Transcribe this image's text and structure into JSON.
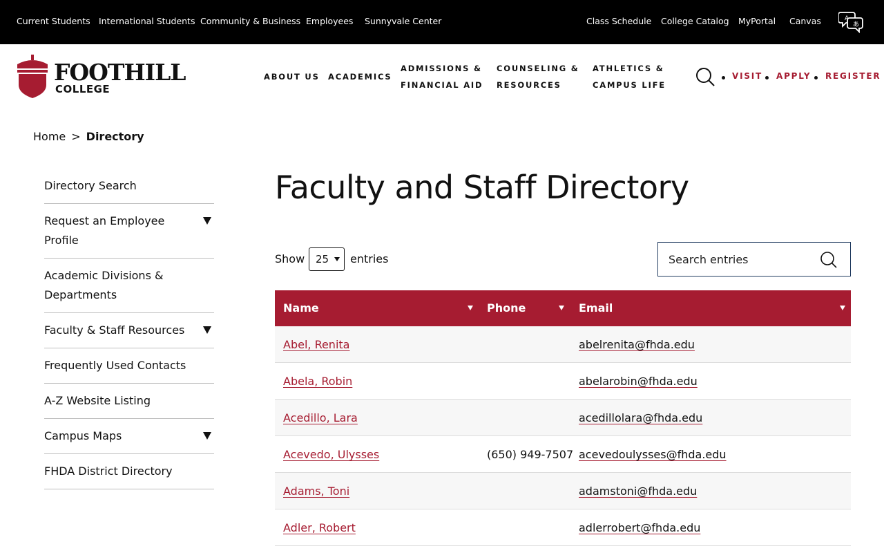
{
  "utility_nav": {
    "left": [
      "Current Students",
      "International Students",
      "Community & Business",
      "Employees",
      "Sunnyvale Center"
    ],
    "right": [
      "Class Schedule",
      "College Catalog",
      "MyPortal",
      "Canvas"
    ],
    "translate_icon": "translate-icon"
  },
  "logo": {
    "line1": "FOOTHILL",
    "line2": "COLLEGE",
    "icon": "acorn-icon"
  },
  "main_nav": {
    "about": "ABOUT US",
    "academics": "ACADEMICS",
    "admissions_1": "ADMISSIONS &",
    "admissions_2": "FINANCIAL AID",
    "counseling_1": "COUNSELING &",
    "counseling_2": "RESOURCES",
    "athletics_1": "ATHLETICS &",
    "athletics_2": "CAMPUS LIFE"
  },
  "cta": {
    "visit": "VISIT",
    "apply": "APPLY",
    "register": "REGISTER"
  },
  "breadcrumb": {
    "home": "Home",
    "separator": ">",
    "current": "Directory"
  },
  "sidebar": {
    "items": [
      {
        "label": "Directory Search"
      },
      {
        "label": "Request an Employee Profile"
      },
      {
        "label": "Academic Divisions & Departments"
      },
      {
        "label": "Faculty & Staff Resources"
      },
      {
        "label": "Frequently Used Contacts"
      },
      {
        "label": "A-Z Website Listing"
      },
      {
        "label": "Campus Maps"
      },
      {
        "label": "FHDA District Directory"
      }
    ]
  },
  "main": {
    "title": "Faculty and Staff Directory",
    "show_label": "Show",
    "page_size": "25",
    "entries_label": "entries",
    "search_placeholder": "Search entries"
  },
  "table": {
    "headers": {
      "name": "Name",
      "phone": "Phone",
      "email": "Email"
    },
    "rows": [
      {
        "name": "Abel, Renita",
        "phone": "",
        "email": "abelrenita@fhda.edu"
      },
      {
        "name": "Abela, Robin",
        "phone": "",
        "email": "abelarobin@fhda.edu"
      },
      {
        "name": "Acedillo, Lara",
        "phone": "",
        "email": "acedillolara@fhda.edu"
      },
      {
        "name": "Acevedo, Ulysses",
        "phone": "(650) 949-7507",
        "email": "acevedoulysses@fhda.edu"
      },
      {
        "name": "Adams, Toni",
        "phone": "",
        "email": "adamstoni@fhda.edu"
      },
      {
        "name": "Adler, Robert",
        "phone": "",
        "email": "adlerrobert@fhda.edu"
      }
    ]
  },
  "colors": {
    "brand": "#a61c31",
    "utility_bg": "#000000"
  }
}
